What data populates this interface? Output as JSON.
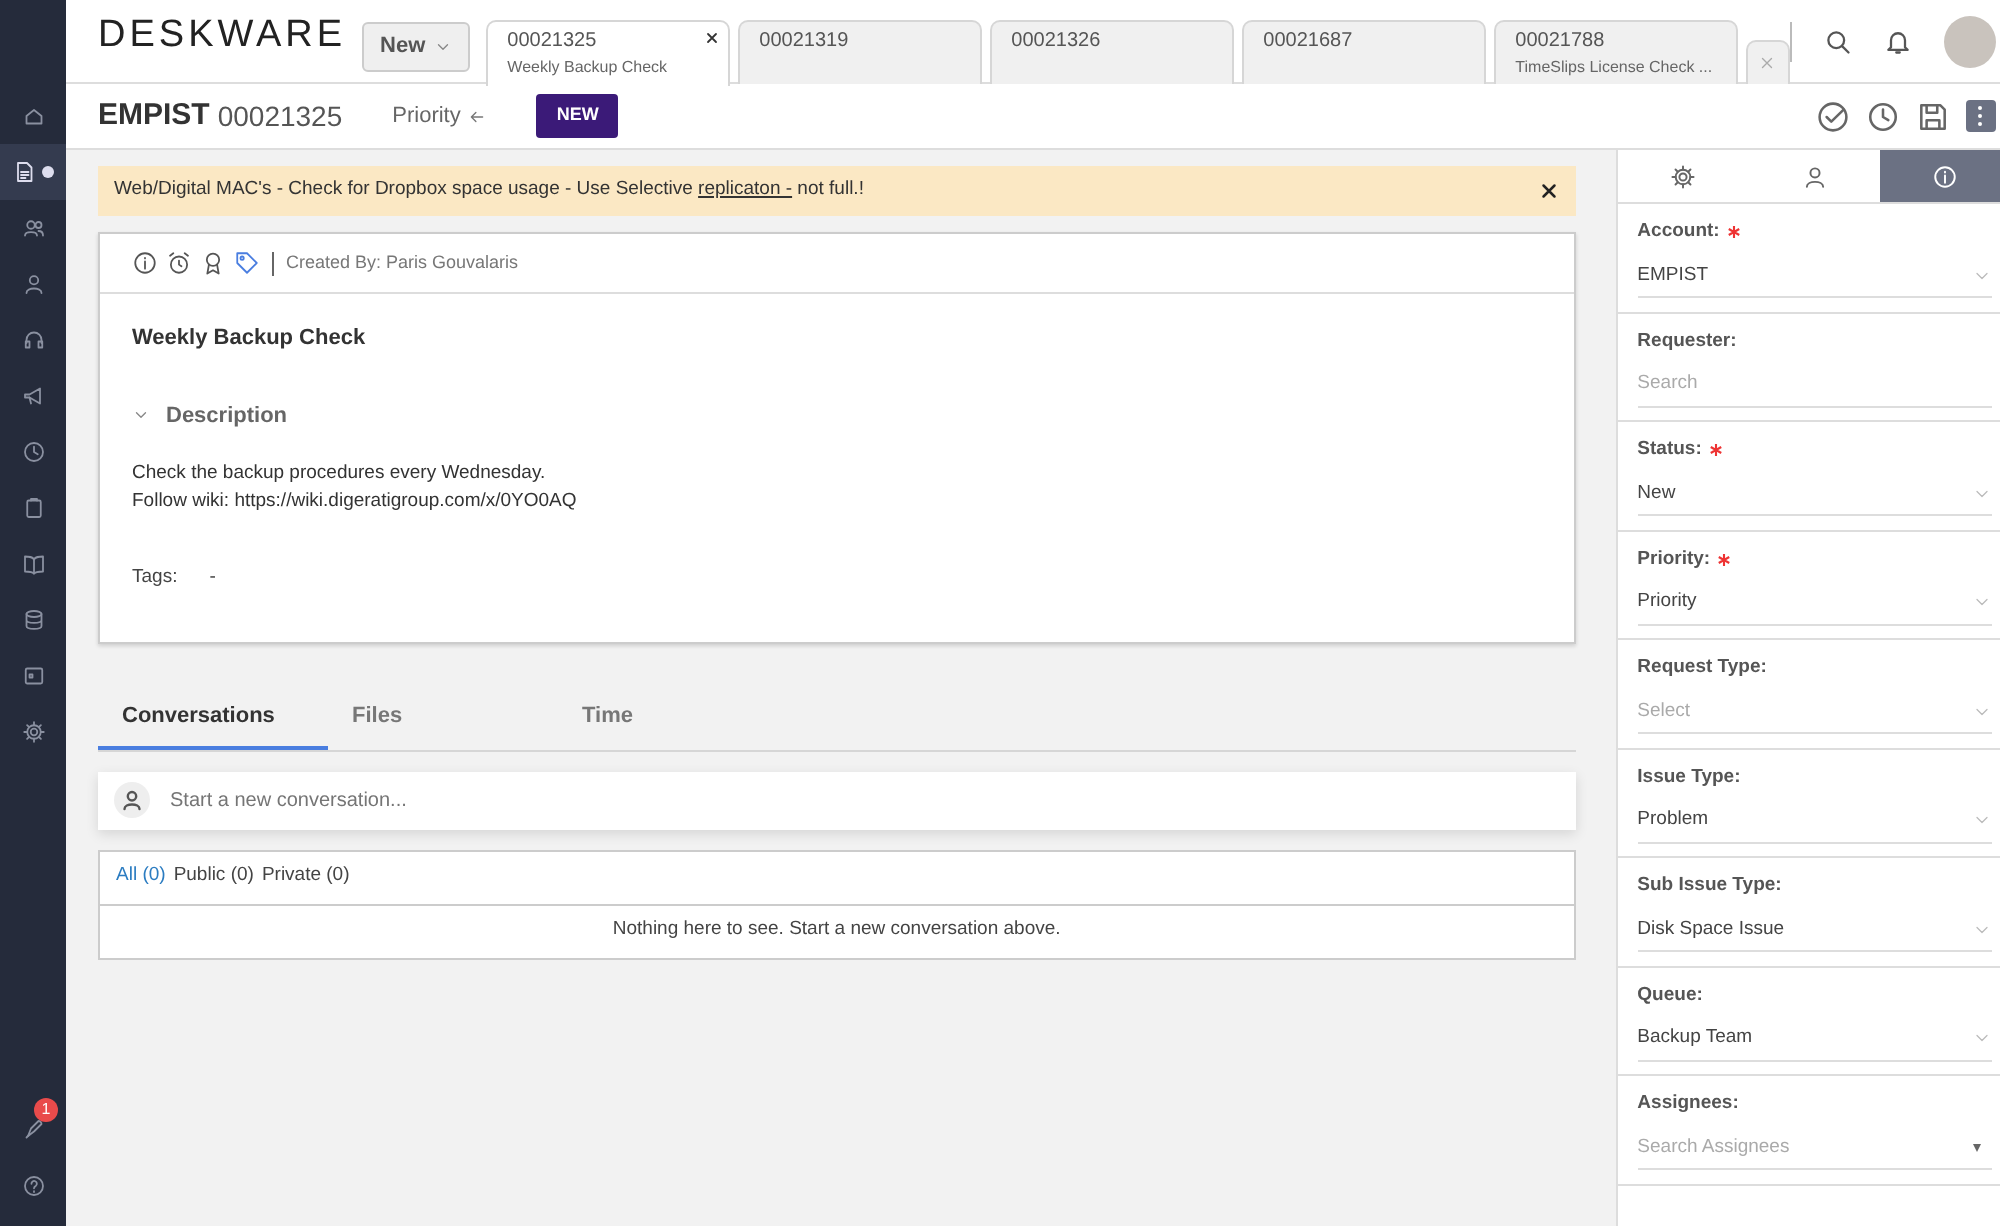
{
  "sidebar": {
    "items": [
      {
        "selected": false
      },
      {
        "selected": true
      },
      {
        "selected": false
      },
      {
        "selected": false
      },
      {
        "selected": false
      },
      {
        "selected": false
      },
      {
        "selected": false
      },
      {
        "selected": false
      },
      {
        "selected": false
      },
      {
        "selected": false
      },
      {
        "selected": false
      },
      {
        "selected": false
      }
    ],
    "notification_badge": "1"
  },
  "header": {
    "logo": "DESKWARE",
    "new_button": "New",
    "tabs": [
      {
        "number": "00021325",
        "subtitle": "Weekly Backup Check",
        "selected": true
      },
      {
        "number": "00021319",
        "selected": false
      },
      {
        "number": "00021326",
        "selected": false
      },
      {
        "number": "00021687",
        "selected": false
      },
      {
        "number": "00021788",
        "subtitle": "TimeSlips License Check ...",
        "selected": false
      }
    ]
  },
  "ticket": {
    "account": "EMPIST",
    "number": "00021325",
    "priority": "Priority",
    "status_badge": "NEW"
  },
  "alert": {
    "text_before": "Web/Digital MAC's - Check for Dropbox space usage - Use Selective ",
    "link": "replicaton -",
    "text_after": " not full.!"
  },
  "card": {
    "created_by": "Created By: Paris Gouvalaris",
    "title": "Weekly Backup Check",
    "description": {
      "heading": "Description",
      "expanded": true,
      "lines": [
        "Check the backup procedures every Wednesday.",
        "Follow wiki: https://wiki.digeratigroup.com/x/0YO0AQ"
      ]
    },
    "tags_label": "Tags:",
    "tags_value": "-"
  },
  "conversation_tabs": [
    {
      "label": "Conversations",
      "selected": true
    },
    {
      "label": "Files",
      "selected": false
    },
    {
      "label": "Time",
      "selected": false
    }
  ],
  "composer": {
    "placeholder": "Start a new conversation..."
  },
  "filters": [
    {
      "label": "All (0)",
      "selected": true
    },
    {
      "label": "Public (0)",
      "selected": false
    },
    {
      "label": "Private (0)",
      "selected": false
    }
  ],
  "empty_message": "Nothing here to see. Start a new conversation above.",
  "detail_tabs": [
    {
      "selected": false
    },
    {
      "selected": false
    },
    {
      "selected": true
    }
  ],
  "fields": [
    {
      "label": "Account:",
      "required": true,
      "kind": "select",
      "value": "EMPIST"
    },
    {
      "label": "Requester:",
      "required": false,
      "kind": "search",
      "placeholder": "Search"
    },
    {
      "label": "Status:",
      "required": true,
      "kind": "select",
      "value": "New"
    },
    {
      "label": "Priority:",
      "required": true,
      "kind": "select",
      "value": "Priority"
    },
    {
      "label": "Request Type:",
      "required": false,
      "kind": "select",
      "placeholder": "Select"
    },
    {
      "label": "Issue Type:",
      "required": false,
      "kind": "select",
      "value": "Problem"
    },
    {
      "label": "Sub Issue Type:",
      "required": false,
      "kind": "select",
      "value": "Disk Space Issue"
    },
    {
      "label": "Queue:",
      "required": false,
      "kind": "select",
      "value": "Backup Team"
    },
    {
      "label": "Assignees:",
      "required": false,
      "kind": "multi",
      "placeholder": "Search Assignees"
    }
  ]
}
